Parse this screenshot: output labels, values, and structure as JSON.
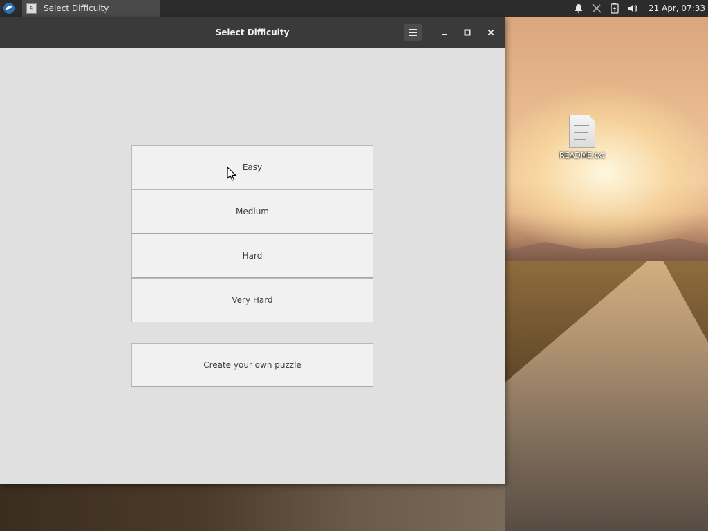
{
  "taskbar": {
    "task_title": "Select Difficulty",
    "task_icon_glyph": "9",
    "clock": "21 Apr, 07:33",
    "tray_icons": [
      "bell-icon",
      "network-disconnected-icon",
      "battery-charging-icon",
      "volume-icon"
    ]
  },
  "window": {
    "title": "Select Difficulty",
    "controls": [
      "hamburger-menu-icon",
      "minimize-icon",
      "maximize-icon",
      "close-icon"
    ]
  },
  "difficulty_options": [
    "Easy",
    "Medium",
    "Hard",
    "Very Hard"
  ],
  "create_puzzle_label": "Create your own puzzle",
  "desktop": {
    "icons": [
      {
        "label": "README.txt",
        "icon": "text-file-icon"
      }
    ]
  },
  "colors": {
    "panel_bg": "#2c2c2c",
    "titlebar_bg": "#3a3a3a",
    "window_bg": "#e0e0e0",
    "button_bg": "#f1f1f1"
  }
}
